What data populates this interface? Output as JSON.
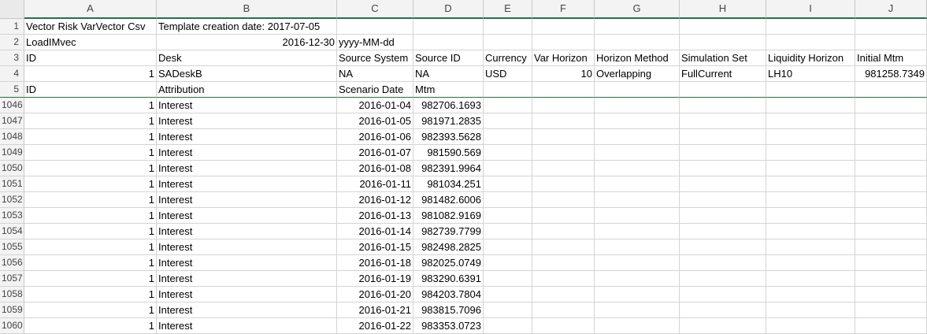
{
  "columns": [
    "A",
    "B",
    "C",
    "D",
    "E",
    "F",
    "G",
    "H",
    "I",
    "J"
  ],
  "rows": [
    {
      "num": "1",
      "cells": [
        {
          "v": "Vector Risk VarVector Csv",
          "a": "l"
        },
        {
          "v": "Template creation date: 2017-07-05",
          "a": "l"
        },
        {
          "v": "",
          "a": "l"
        },
        {
          "v": "",
          "a": "l"
        },
        {
          "v": "",
          "a": "l"
        },
        {
          "v": "",
          "a": "l"
        },
        {
          "v": "",
          "a": "l"
        },
        {
          "v": "",
          "a": "l"
        },
        {
          "v": "",
          "a": "l"
        },
        {
          "v": "",
          "a": "l"
        }
      ]
    },
    {
      "num": "2",
      "cells": [
        {
          "v": "LoadIMvec",
          "a": "l"
        },
        {
          "v": "2016-12-30",
          "a": "r"
        },
        {
          "v": "yyyy-MM-dd",
          "a": "l"
        },
        {
          "v": "",
          "a": "l"
        },
        {
          "v": "",
          "a": "l"
        },
        {
          "v": "",
          "a": "l"
        },
        {
          "v": "",
          "a": "l"
        },
        {
          "v": "",
          "a": "l"
        },
        {
          "v": "",
          "a": "l"
        },
        {
          "v": "",
          "a": "l"
        }
      ]
    },
    {
      "num": "3",
      "cells": [
        {
          "v": "ID",
          "a": "l"
        },
        {
          "v": "Desk",
          "a": "l"
        },
        {
          "v": "Source System",
          "a": "l"
        },
        {
          "v": "Source ID",
          "a": "l"
        },
        {
          "v": "Currency",
          "a": "l"
        },
        {
          "v": "Var Horizon",
          "a": "l"
        },
        {
          "v": "Horizon Method",
          "a": "l"
        },
        {
          "v": "Simulation Set",
          "a": "l"
        },
        {
          "v": "Liquidity Horizon",
          "a": "l"
        },
        {
          "v": "Initial Mtm",
          "a": "l"
        }
      ]
    },
    {
      "num": "4",
      "cells": [
        {
          "v": "1",
          "a": "r"
        },
        {
          "v": "SADeskB",
          "a": "l"
        },
        {
          "v": "NA",
          "a": "l"
        },
        {
          "v": "NA",
          "a": "l"
        },
        {
          "v": "USD",
          "a": "l"
        },
        {
          "v": "10",
          "a": "r"
        },
        {
          "v": "Overlapping",
          "a": "l"
        },
        {
          "v": "FullCurrent",
          "a": "l"
        },
        {
          "v": "LH10",
          "a": "l"
        },
        {
          "v": "981258.7349",
          "a": "r"
        }
      ]
    },
    {
      "num": "5",
      "frozen": true,
      "cells": [
        {
          "v": "ID",
          "a": "l"
        },
        {
          "v": "Attribution",
          "a": "l"
        },
        {
          "v": "Scenario Date",
          "a": "l"
        },
        {
          "v": "Mtm",
          "a": "l"
        },
        {
          "v": "",
          "a": "l"
        },
        {
          "v": "",
          "a": "l"
        },
        {
          "v": "",
          "a": "l"
        },
        {
          "v": "",
          "a": "l"
        },
        {
          "v": "",
          "a": "l"
        },
        {
          "v": "",
          "a": "l"
        }
      ]
    },
    {
      "num": "1046",
      "cells": [
        {
          "v": "1",
          "a": "r"
        },
        {
          "v": "Interest",
          "a": "l"
        },
        {
          "v": "2016-01-04",
          "a": "r"
        },
        {
          "v": "982706.1693",
          "a": "r"
        },
        {
          "v": "",
          "a": "l"
        },
        {
          "v": "",
          "a": "l"
        },
        {
          "v": "",
          "a": "l"
        },
        {
          "v": "",
          "a": "l"
        },
        {
          "v": "",
          "a": "l"
        },
        {
          "v": "",
          "a": "l"
        }
      ]
    },
    {
      "num": "1047",
      "cells": [
        {
          "v": "1",
          "a": "r"
        },
        {
          "v": "Interest",
          "a": "l"
        },
        {
          "v": "2016-01-05",
          "a": "r"
        },
        {
          "v": "981971.2835",
          "a": "r"
        },
        {
          "v": "",
          "a": "l"
        },
        {
          "v": "",
          "a": "l"
        },
        {
          "v": "",
          "a": "l"
        },
        {
          "v": "",
          "a": "l"
        },
        {
          "v": "",
          "a": "l"
        },
        {
          "v": "",
          "a": "l"
        }
      ]
    },
    {
      "num": "1048",
      "cells": [
        {
          "v": "1",
          "a": "r"
        },
        {
          "v": "Interest",
          "a": "l"
        },
        {
          "v": "2016-01-06",
          "a": "r"
        },
        {
          "v": "982393.5628",
          "a": "r"
        },
        {
          "v": "",
          "a": "l"
        },
        {
          "v": "",
          "a": "l"
        },
        {
          "v": "",
          "a": "l"
        },
        {
          "v": "",
          "a": "l"
        },
        {
          "v": "",
          "a": "l"
        },
        {
          "v": "",
          "a": "l"
        }
      ]
    },
    {
      "num": "1049",
      "cells": [
        {
          "v": "1",
          "a": "r"
        },
        {
          "v": "Interest",
          "a": "l"
        },
        {
          "v": "2016-01-07",
          "a": "r"
        },
        {
          "v": "981590.569",
          "a": "r"
        },
        {
          "v": "",
          "a": "l"
        },
        {
          "v": "",
          "a": "l"
        },
        {
          "v": "",
          "a": "l"
        },
        {
          "v": "",
          "a": "l"
        },
        {
          "v": "",
          "a": "l"
        },
        {
          "v": "",
          "a": "l"
        }
      ]
    },
    {
      "num": "1050",
      "cells": [
        {
          "v": "1",
          "a": "r"
        },
        {
          "v": "Interest",
          "a": "l"
        },
        {
          "v": "2016-01-08",
          "a": "r"
        },
        {
          "v": "982391.9964",
          "a": "r"
        },
        {
          "v": "",
          "a": "l"
        },
        {
          "v": "",
          "a": "l"
        },
        {
          "v": "",
          "a": "l"
        },
        {
          "v": "",
          "a": "l"
        },
        {
          "v": "",
          "a": "l"
        },
        {
          "v": "",
          "a": "l"
        }
      ]
    },
    {
      "num": "1051",
      "cells": [
        {
          "v": "1",
          "a": "r"
        },
        {
          "v": "Interest",
          "a": "l"
        },
        {
          "v": "2016-01-11",
          "a": "r"
        },
        {
          "v": "981034.251",
          "a": "r"
        },
        {
          "v": "",
          "a": "l"
        },
        {
          "v": "",
          "a": "l"
        },
        {
          "v": "",
          "a": "l"
        },
        {
          "v": "",
          "a": "l"
        },
        {
          "v": "",
          "a": "l"
        },
        {
          "v": "",
          "a": "l"
        }
      ]
    },
    {
      "num": "1052",
      "cells": [
        {
          "v": "1",
          "a": "r"
        },
        {
          "v": "Interest",
          "a": "l"
        },
        {
          "v": "2016-01-12",
          "a": "r"
        },
        {
          "v": "981482.6006",
          "a": "r"
        },
        {
          "v": "",
          "a": "l"
        },
        {
          "v": "",
          "a": "l"
        },
        {
          "v": "",
          "a": "l"
        },
        {
          "v": "",
          "a": "l"
        },
        {
          "v": "",
          "a": "l"
        },
        {
          "v": "",
          "a": "l"
        }
      ]
    },
    {
      "num": "1053",
      "cells": [
        {
          "v": "1",
          "a": "r"
        },
        {
          "v": "Interest",
          "a": "l"
        },
        {
          "v": "2016-01-13",
          "a": "r"
        },
        {
          "v": "981082.9169",
          "a": "r"
        },
        {
          "v": "",
          "a": "l"
        },
        {
          "v": "",
          "a": "l"
        },
        {
          "v": "",
          "a": "l"
        },
        {
          "v": "",
          "a": "l"
        },
        {
          "v": "",
          "a": "l"
        },
        {
          "v": "",
          "a": "l"
        }
      ]
    },
    {
      "num": "1054",
      "cells": [
        {
          "v": "1",
          "a": "r"
        },
        {
          "v": "Interest",
          "a": "l"
        },
        {
          "v": "2016-01-14",
          "a": "r"
        },
        {
          "v": "982739.7799",
          "a": "r"
        },
        {
          "v": "",
          "a": "l"
        },
        {
          "v": "",
          "a": "l"
        },
        {
          "v": "",
          "a": "l"
        },
        {
          "v": "",
          "a": "l"
        },
        {
          "v": "",
          "a": "l"
        },
        {
          "v": "",
          "a": "l"
        }
      ]
    },
    {
      "num": "1055",
      "cells": [
        {
          "v": "1",
          "a": "r"
        },
        {
          "v": "Interest",
          "a": "l"
        },
        {
          "v": "2016-01-15",
          "a": "r"
        },
        {
          "v": "982498.2825",
          "a": "r"
        },
        {
          "v": "",
          "a": "l"
        },
        {
          "v": "",
          "a": "l"
        },
        {
          "v": "",
          "a": "l"
        },
        {
          "v": "",
          "a": "l"
        },
        {
          "v": "",
          "a": "l"
        },
        {
          "v": "",
          "a": "l"
        }
      ]
    },
    {
      "num": "1056",
      "cells": [
        {
          "v": "1",
          "a": "r"
        },
        {
          "v": "Interest",
          "a": "l"
        },
        {
          "v": "2016-01-18",
          "a": "r"
        },
        {
          "v": "982025.0749",
          "a": "r"
        },
        {
          "v": "",
          "a": "l"
        },
        {
          "v": "",
          "a": "l"
        },
        {
          "v": "",
          "a": "l"
        },
        {
          "v": "",
          "a": "l"
        },
        {
          "v": "",
          "a": "l"
        },
        {
          "v": "",
          "a": "l"
        }
      ]
    },
    {
      "num": "1057",
      "cells": [
        {
          "v": "1",
          "a": "r"
        },
        {
          "v": "Interest",
          "a": "l"
        },
        {
          "v": "2016-01-19",
          "a": "r"
        },
        {
          "v": "983290.6391",
          "a": "r"
        },
        {
          "v": "",
          "a": "l"
        },
        {
          "v": "",
          "a": "l"
        },
        {
          "v": "",
          "a": "l"
        },
        {
          "v": "",
          "a": "l"
        },
        {
          "v": "",
          "a": "l"
        },
        {
          "v": "",
          "a": "l"
        }
      ]
    },
    {
      "num": "1058",
      "cells": [
        {
          "v": "1",
          "a": "r"
        },
        {
          "v": "Interest",
          "a": "l"
        },
        {
          "v": "2016-01-20",
          "a": "r"
        },
        {
          "v": "984203.7804",
          "a": "r"
        },
        {
          "v": "",
          "a": "l"
        },
        {
          "v": "",
          "a": "l"
        },
        {
          "v": "",
          "a": "l"
        },
        {
          "v": "",
          "a": "l"
        },
        {
          "v": "",
          "a": "l"
        },
        {
          "v": "",
          "a": "l"
        }
      ]
    },
    {
      "num": "1059",
      "cells": [
        {
          "v": "1",
          "a": "r"
        },
        {
          "v": "Interest",
          "a": "l"
        },
        {
          "v": "2016-01-21",
          "a": "r"
        },
        {
          "v": "983815.7096",
          "a": "r"
        },
        {
          "v": "",
          "a": "l"
        },
        {
          "v": "",
          "a": "l"
        },
        {
          "v": "",
          "a": "l"
        },
        {
          "v": "",
          "a": "l"
        },
        {
          "v": "",
          "a": "l"
        },
        {
          "v": "",
          "a": "l"
        }
      ]
    },
    {
      "num": "1060",
      "cells": [
        {
          "v": "1",
          "a": "r"
        },
        {
          "v": "Interest",
          "a": "l"
        },
        {
          "v": "2016-01-22",
          "a": "r"
        },
        {
          "v": "983353.0723",
          "a": "r"
        },
        {
          "v": "",
          "a": "l"
        },
        {
          "v": "",
          "a": "l"
        },
        {
          "v": "",
          "a": "l"
        },
        {
          "v": "",
          "a": "l"
        },
        {
          "v": "",
          "a": "l"
        },
        {
          "v": "",
          "a": "l"
        }
      ]
    }
  ]
}
